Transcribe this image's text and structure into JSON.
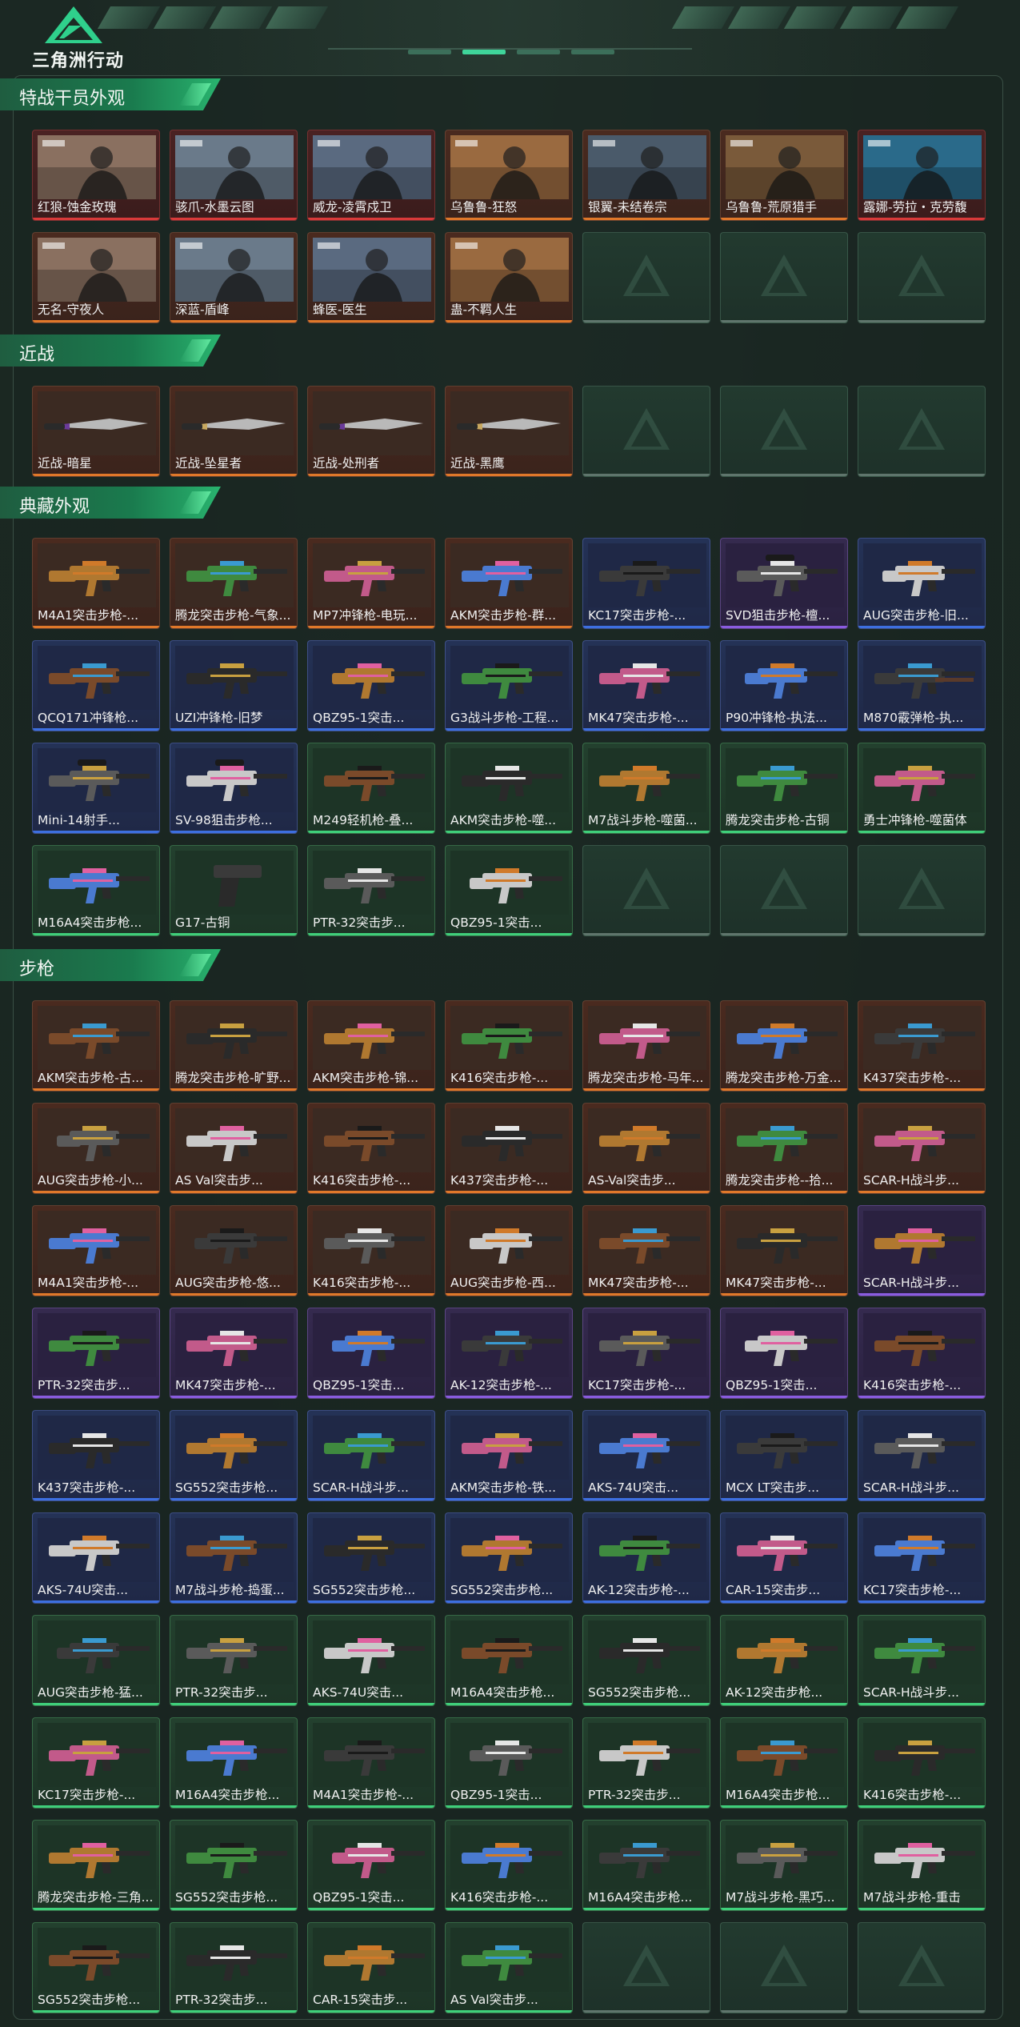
{
  "header": {
    "title": "三角洲行动",
    "logo_icon": "delta-force-logo-icon"
  },
  "sections": [
    {
      "key": "operators",
      "title": "特战干员外观",
      "items": [
        {
          "name": "红狼-蚀金玫瑰",
          "rarity": "red",
          "art": "operator"
        },
        {
          "name": "骇爪-水墨云图",
          "rarity": "red",
          "art": "operator"
        },
        {
          "name": "威龙-凌霄戍卫",
          "rarity": "red",
          "art": "operator"
        },
        {
          "name": "乌鲁鲁-狂怒",
          "rarity": "orange",
          "art": "operator"
        },
        {
          "name": "银翼-未结卷宗",
          "rarity": "orange",
          "art": "operator"
        },
        {
          "name": "乌鲁鲁-荒原猎手",
          "rarity": "orange",
          "art": "operator"
        },
        {
          "name": "露娜-劳拉・克劳馥",
          "rarity": "red",
          "art": "operator"
        },
        {
          "name": "无名-守夜人",
          "rarity": "orange",
          "art": "operator"
        },
        {
          "name": "深蓝-盾峰",
          "rarity": "orange",
          "art": "operator"
        },
        {
          "name": "蜂医-医生",
          "rarity": "orange",
          "art": "operator"
        },
        {
          "name": "蛊-不羁人生",
          "rarity": "orange",
          "art": "operator"
        }
      ],
      "empty_slots": 3
    },
    {
      "key": "melee",
      "title": "近战",
      "items": [
        {
          "name": "近战-暗星",
          "rarity": "orange",
          "art": "knife"
        },
        {
          "name": "近战-坠星者",
          "rarity": "orange",
          "art": "knife"
        },
        {
          "name": "近战-处刑者",
          "rarity": "orange",
          "art": "knife"
        },
        {
          "name": "近战-黑鹰",
          "rarity": "orange",
          "art": "knife"
        }
      ],
      "empty_slots": 3
    },
    {
      "key": "collection",
      "title": "典藏外观",
      "items": [
        {
          "name": "M4A1突击步枪-...",
          "rarity": "orange",
          "art": "rifle"
        },
        {
          "name": "腾龙突击步枪-气象...",
          "rarity": "orange",
          "art": "rifle"
        },
        {
          "name": "MP7冲锋枪-电玩...",
          "rarity": "orange",
          "art": "smg"
        },
        {
          "name": "AKM突击步枪-群...",
          "rarity": "orange",
          "art": "rifle"
        },
        {
          "name": "KC17突击步枪-...",
          "rarity": "blue",
          "art": "rifle"
        },
        {
          "name": "SVD狙击步枪-檀...",
          "rarity": "purple",
          "art": "sniper"
        },
        {
          "name": "AUG突击步枪-旧...",
          "rarity": "blue",
          "art": "bullpup"
        },
        {
          "name": "QCQ171冲锋枪...",
          "rarity": "blue",
          "art": "smg"
        },
        {
          "name": "UZI冲锋枪-旧梦",
          "rarity": "blue",
          "art": "smg"
        },
        {
          "name": "QBZ95-1突击...",
          "rarity": "blue",
          "art": "bullpup"
        },
        {
          "name": "G3战斗步枪-工程...",
          "rarity": "blue",
          "art": "rifle"
        },
        {
          "name": "MK47突击步枪-...",
          "rarity": "blue",
          "art": "rifle"
        },
        {
          "name": "P90冲锋枪-执法...",
          "rarity": "blue",
          "art": "bullpup"
        },
        {
          "name": "M870霰弹枪-执...",
          "rarity": "blue",
          "art": "shotgun"
        },
        {
          "name": "Mini-14射手...",
          "rarity": "blue",
          "art": "sniper"
        },
        {
          "name": "SV-98狙击步枪...",
          "rarity": "blue",
          "art": "sniper"
        },
        {
          "name": "M249轻机枪-叠...",
          "rarity": "green",
          "art": "rifle"
        },
        {
          "name": "AKM突击步枪-噬...",
          "rarity": "green",
          "art": "rifle"
        },
        {
          "name": "M7战斗步枪-噬菌...",
          "rarity": "green",
          "art": "rifle"
        },
        {
          "name": "腾龙突击步枪-古铜",
          "rarity": "green",
          "art": "rifle"
        },
        {
          "name": "勇士冲锋枪-噬菌体",
          "rarity": "green",
          "art": "smg"
        },
        {
          "name": "M16A4突击步枪...",
          "rarity": "green",
          "art": "rifle"
        },
        {
          "name": "G17-古铜",
          "rarity": "green",
          "art": "pistol"
        },
        {
          "name": "PTR-32突击步...",
          "rarity": "green",
          "art": "rifle"
        },
        {
          "name": "QBZ95-1突击...",
          "rarity": "green",
          "art": "bullpup"
        }
      ],
      "empty_slots": 3
    },
    {
      "key": "rifles",
      "title": "步枪",
      "items": [
        {
          "name": "AKM突击步枪-古...",
          "rarity": "orange",
          "art": "rifle"
        },
        {
          "name": "腾龙突击步枪-旷野...",
          "rarity": "orange",
          "art": "rifle"
        },
        {
          "name": "AKM突击步枪-锦...",
          "rarity": "orange",
          "art": "rifle"
        },
        {
          "name": "K416突击步枪-...",
          "rarity": "orange",
          "art": "rifle"
        },
        {
          "name": "腾龙突击步枪-马年...",
          "rarity": "orange",
          "art": "rifle"
        },
        {
          "name": "腾龙突击步枪-万金...",
          "rarity": "orange",
          "art": "rifle"
        },
        {
          "name": "K437突击步枪-...",
          "rarity": "orange",
          "art": "rifle"
        },
        {
          "name": "AUG突击步枪-小...",
          "rarity": "orange",
          "art": "bullpup"
        },
        {
          "name": "AS Val突击步...",
          "rarity": "orange",
          "art": "rifle"
        },
        {
          "name": "K416突击步枪-...",
          "rarity": "orange",
          "art": "rifle"
        },
        {
          "name": "K437突击步枪-...",
          "rarity": "orange",
          "art": "rifle"
        },
        {
          "name": "AS-Val突击步...",
          "rarity": "orange",
          "art": "rifle"
        },
        {
          "name": "腾龙突击步枪--拾...",
          "rarity": "orange",
          "art": "rifle"
        },
        {
          "name": "SCAR-H战斗步...",
          "rarity": "orange",
          "art": "rifle"
        },
        {
          "name": "M4A1突击步枪-...",
          "rarity": "orange",
          "art": "rifle"
        },
        {
          "name": "AUG突击步枪-悠...",
          "rarity": "orange",
          "art": "bullpup"
        },
        {
          "name": "K416突击步枪-...",
          "rarity": "orange",
          "art": "rifle"
        },
        {
          "name": "AUG突击步枪-西...",
          "rarity": "orange",
          "art": "bullpup"
        },
        {
          "name": "MK47突击步枪-...",
          "rarity": "orange",
          "art": "rifle"
        },
        {
          "name": "MK47突击步枪-...",
          "rarity": "orange",
          "art": "rifle"
        },
        {
          "name": "SCAR-H战斗步...",
          "rarity": "purple",
          "art": "rifle"
        },
        {
          "name": "PTR-32突击步...",
          "rarity": "purple",
          "art": "rifle"
        },
        {
          "name": "MK47突击步枪-...",
          "rarity": "purple",
          "art": "rifle"
        },
        {
          "name": "QBZ95-1突击...",
          "rarity": "purple",
          "art": "bullpup"
        },
        {
          "name": "AK-12突击步枪-...",
          "rarity": "purple",
          "art": "rifle"
        },
        {
          "name": "KC17突击步枪-...",
          "rarity": "purple",
          "art": "rifle"
        },
        {
          "name": "QBZ95-1突击...",
          "rarity": "purple",
          "art": "bullpup"
        },
        {
          "name": "K416突击步枪-...",
          "rarity": "purple",
          "art": "rifle"
        },
        {
          "name": "K437突击步枪-...",
          "rarity": "blue",
          "art": "rifle"
        },
        {
          "name": "SG552突击步枪...",
          "rarity": "blue",
          "art": "rifle"
        },
        {
          "name": "SCAR-H战斗步...",
          "rarity": "blue",
          "art": "rifle"
        },
        {
          "name": "AKM突击步枪-铁...",
          "rarity": "blue",
          "art": "rifle"
        },
        {
          "name": "AKS-74U突击...",
          "rarity": "blue",
          "art": "rifle"
        },
        {
          "name": "MCX LT突击步...",
          "rarity": "blue",
          "art": "rifle"
        },
        {
          "name": "SCAR-H战斗步...",
          "rarity": "blue",
          "art": "rifle"
        },
        {
          "name": "AKS-74U突击...",
          "rarity": "blue",
          "art": "rifle"
        },
        {
          "name": "M7战斗步枪-捣蛋...",
          "rarity": "blue",
          "art": "rifle"
        },
        {
          "name": "SG552突击步枪...",
          "rarity": "blue",
          "art": "rifle"
        },
        {
          "name": "SG552突击步枪...",
          "rarity": "blue",
          "art": "rifle"
        },
        {
          "name": "AK-12突击步枪-...",
          "rarity": "blue",
          "art": "rifle"
        },
        {
          "name": "CAR-15突击步...",
          "rarity": "blue",
          "art": "rifle"
        },
        {
          "name": "KC17突击步枪-...",
          "rarity": "blue",
          "art": "rifle"
        },
        {
          "name": "AUG突击步枪-猛...",
          "rarity": "green",
          "art": "bullpup"
        },
        {
          "name": "PTR-32突击步...",
          "rarity": "green",
          "art": "rifle"
        },
        {
          "name": "AKS-74U突击...",
          "rarity": "green",
          "art": "rifle"
        },
        {
          "name": "M16A4突击步枪...",
          "rarity": "green",
          "art": "rifle"
        },
        {
          "name": "SG552突击步枪...",
          "rarity": "green",
          "art": "rifle"
        },
        {
          "name": "AK-12突击步枪...",
          "rarity": "green",
          "art": "rifle"
        },
        {
          "name": "SCAR-H战斗步...",
          "rarity": "green",
          "art": "rifle"
        },
        {
          "name": "KC17突击步枪-...",
          "rarity": "green",
          "art": "rifle"
        },
        {
          "name": "M16A4突击步枪...",
          "rarity": "green",
          "art": "rifle"
        },
        {
          "name": "M4A1突击步枪-...",
          "rarity": "green",
          "art": "rifle"
        },
        {
          "name": "QBZ95-1突击...",
          "rarity": "green",
          "art": "bullpup"
        },
        {
          "name": "PTR-32突击步...",
          "rarity": "green",
          "art": "rifle"
        },
        {
          "name": "M16A4突击步枪...",
          "rarity": "green",
          "art": "rifle"
        },
        {
          "name": "K416突击步枪-...",
          "rarity": "green",
          "art": "rifle"
        },
        {
          "name": "腾龙突击步枪-三角...",
          "rarity": "green",
          "art": "rifle"
        },
        {
          "name": "SG552突击步枪...",
          "rarity": "green",
          "art": "rifle"
        },
        {
          "name": "QBZ95-1突击...",
          "rarity": "green",
          "art": "bullpup"
        },
        {
          "name": "K416突击步枪-...",
          "rarity": "green",
          "art": "rifle"
        },
        {
          "name": "M16A4突击步枪...",
          "rarity": "green",
          "art": "rifle"
        },
        {
          "name": "M7战斗步枪-黑巧...",
          "rarity": "green",
          "art": "rifle"
        },
        {
          "name": "M7战斗步枪-重击",
          "rarity": "green",
          "art": "rifle"
        },
        {
          "name": "SG552突击步枪...",
          "rarity": "green",
          "art": "rifle"
        },
        {
          "name": "PTR-32突击步...",
          "rarity": "green",
          "art": "rifle"
        },
        {
          "name": "CAR-15突击步...",
          "rarity": "green",
          "art": "rifle"
        },
        {
          "name": "AS Val突击步...",
          "rarity": "green",
          "art": "rifle"
        }
      ],
      "empty_slots": 3
    }
  ],
  "colors": {
    "orange": "#e0782a",
    "red": "#d93a3a",
    "blue": "#3d6fe0",
    "purple": "#8a5ce0",
    "green": "#3fcf7a",
    "accent": "#3fd59a"
  }
}
